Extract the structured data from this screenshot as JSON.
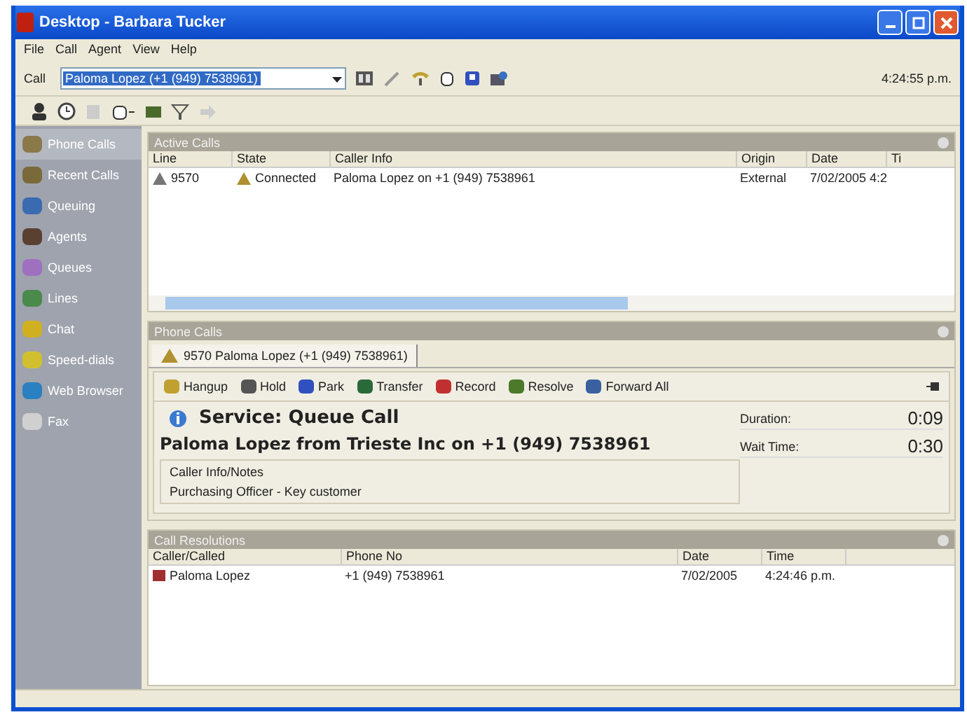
{
  "window": {
    "title": "Desktop - Barbara Tucker"
  },
  "menu": [
    "File",
    "Call",
    "Agent",
    "View",
    "Help"
  ],
  "call_bar": {
    "label": "Call",
    "value": "Paloma Lopez (+1 (949) 7538961)",
    "time": "4:24:55 p.m."
  },
  "sidebar": {
    "items": [
      {
        "label": "Phone Calls",
        "selected": true
      },
      {
        "label": "Recent Calls",
        "selected": false
      },
      {
        "label": "Queuing",
        "selected": false
      },
      {
        "label": "Agents",
        "selected": false
      },
      {
        "label": "Queues",
        "selected": false
      },
      {
        "label": "Lines",
        "selected": false
      },
      {
        "label": "Chat",
        "selected": false
      },
      {
        "label": "Speed-dials",
        "selected": false
      },
      {
        "label": "Web Browser",
        "selected": false
      },
      {
        "label": "Fax",
        "selected": false
      }
    ]
  },
  "active_calls": {
    "title": "Active Calls",
    "columns": [
      "Line",
      "State",
      "Caller Info",
      "Origin",
      "Date",
      "Ti"
    ],
    "rows": [
      {
        "cells": [
          "9570",
          "Connected",
          "Paloma Lopez on +1 (949) 7538961",
          "External",
          "7/02/2005 4:2"
        ]
      }
    ]
  },
  "phone_calls": {
    "title": "Phone Calls",
    "tabs": [
      {
        "label": "9570 Paloma Lopez (+1 (949) 7538961)",
        "selected": true
      }
    ],
    "actions": [
      "Hangup",
      "Hold",
      "Park",
      "Transfer",
      "Record",
      "Resolve",
      "Forward All"
    ],
    "service": "Service: Queue Call",
    "caller": "Paloma Lopez from Trieste Inc on +1 (949) 7538961",
    "duration_label": "Duration:",
    "duration": "0:09",
    "wait_label": "Wait Time:",
    "wait": "0:30",
    "notes_label": "Caller Info/Notes",
    "notes": "Purchasing Officer - Key customer"
  },
  "call_resolutions": {
    "title": "Call Resolutions",
    "columns": [
      "Caller/Called",
      "Phone No",
      "Date",
      "Time"
    ],
    "rows": [
      {
        "cells": [
          "Paloma Lopez",
          "+1 (949) 7538961",
          "7/02/2005",
          "4:24:46 p.m."
        ]
      }
    ]
  }
}
